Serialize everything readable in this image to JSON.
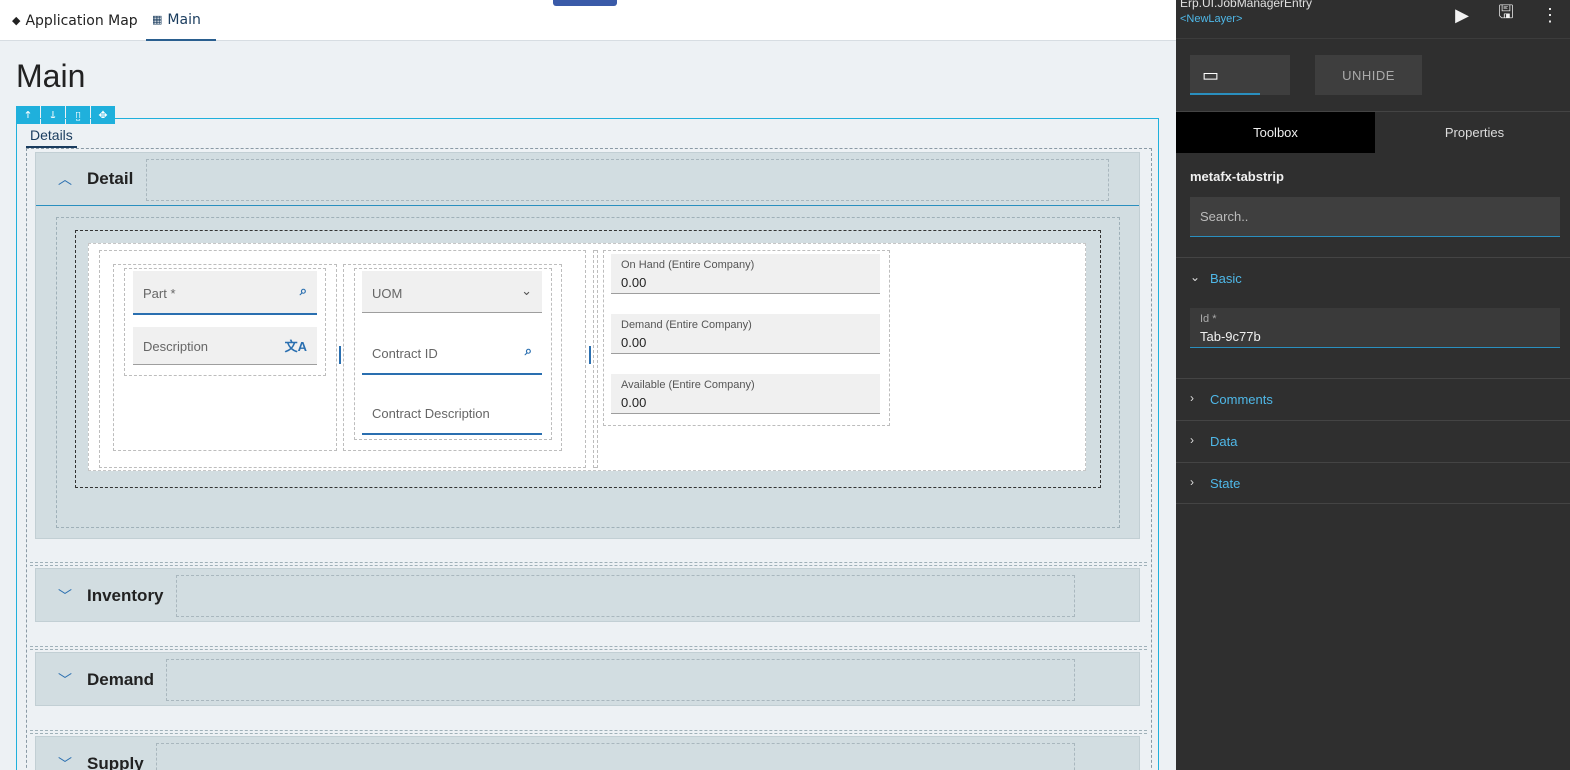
{
  "topnav": {
    "app_map_label": "Application Map",
    "main_label": "Main"
  },
  "page": {
    "title": "Main"
  },
  "tabstrip": {
    "tab_label": "Details"
  },
  "panels": {
    "detail": {
      "title": "Detail",
      "expanded": true
    },
    "inventory": {
      "title": "Inventory",
      "expanded": false
    },
    "demand": {
      "title": "Demand",
      "expanded": false
    },
    "supply": {
      "title": "Supply",
      "expanded": false
    }
  },
  "fields": {
    "part": {
      "label": "Part *",
      "icon": "search-doc-icon"
    },
    "description": {
      "label": "Description",
      "icon": "translate-icon"
    },
    "uom": {
      "label": "UOM",
      "icon": "chevron-down-icon"
    },
    "contract_id": {
      "label": "Contract ID",
      "icon": "search-doc-icon"
    },
    "contract_description": {
      "label": "Contract Description"
    },
    "on_hand": {
      "label": "On Hand (Entire Company)",
      "value": "0.00"
    },
    "demand": {
      "label": "Demand (Entire Company)",
      "value": "0.00"
    },
    "available": {
      "label": "Available (Entire Company)",
      "value": "0.00"
    }
  },
  "properties_panel": {
    "title": "Erp.UI.JobManagerEntry",
    "layer": "<NewLayer>",
    "unhide_label": "UNHIDE",
    "tabs": {
      "toolbox": "Toolbox",
      "properties": "Properties"
    },
    "component_name": "metafx-tabstrip",
    "search_placeholder": "Search..",
    "sections": {
      "basic": "Basic",
      "comments": "Comments",
      "data": "Data",
      "state": "State"
    },
    "id_field": {
      "label": "Id *",
      "value": "Tab-9c77b"
    }
  },
  "colors": {
    "accent": "#1fb0dc",
    "link_blue": "#4fb8e8",
    "panel_bg": "#2f2f2f",
    "section_bg": "#d2dde1"
  }
}
